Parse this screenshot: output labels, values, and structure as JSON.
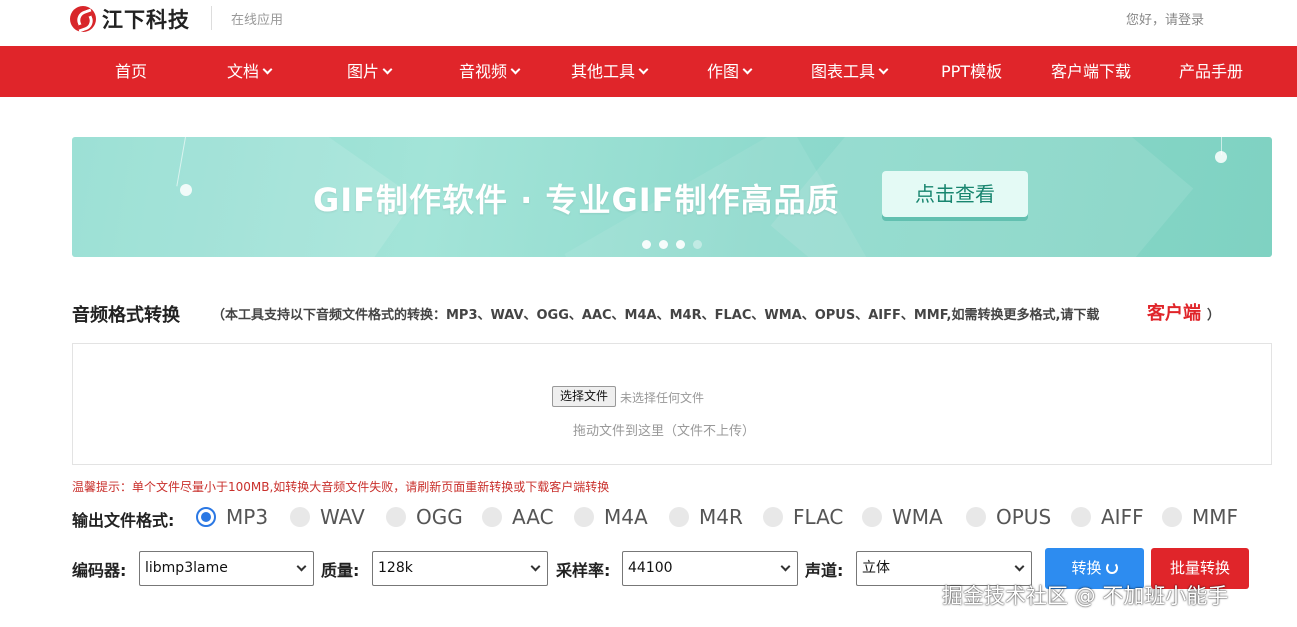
{
  "header": {
    "brand": "江下科技",
    "subtitle": "在线应用",
    "login": "您好，请登录"
  },
  "nav": {
    "items": [
      {
        "label": "首页",
        "dropdown": false
      },
      {
        "label": "文档",
        "dropdown": true
      },
      {
        "label": "图片",
        "dropdown": true
      },
      {
        "label": "音视频",
        "dropdown": true
      },
      {
        "label": "其他工具",
        "dropdown": true
      },
      {
        "label": "作图",
        "dropdown": true
      },
      {
        "label": "图表工具",
        "dropdown": true
      },
      {
        "label": "PPT模板",
        "dropdown": false
      },
      {
        "label": "客户端下载",
        "dropdown": false
      },
      {
        "label": "产品手册",
        "dropdown": false
      }
    ]
  },
  "banner": {
    "title": "GIF制作软件 · 专业GIF制作高品质",
    "button": "点击查看",
    "active_slide": 4,
    "slide_count": 4
  },
  "section": {
    "title": "音频格式转换",
    "description": "（本工具支持以下音频文件格式的转换：MP3、WAV、OGG、AAC、M4A、M4R、FLAC、WMA、OPUS、AIFF、MMF,如需转换更多格式,请下载",
    "client_link": "客户端",
    "close_paren": "）"
  },
  "upload": {
    "choose_button": "选择文件",
    "no_file": "未选择任何文件",
    "drop_hint": "拖动文件到这里（文件不上传）"
  },
  "tip": "温馨提示：单个文件尽量小于100MB,如转换大音频文件失败，请刷新页面重新转换或下载客户端转换",
  "formats": {
    "label": "输出文件格式:",
    "options": [
      "MP3",
      "WAV",
      "OGG",
      "AAC",
      "M4A",
      "M4R",
      "FLAC",
      "WMA",
      "OPUS",
      "AIFF",
      "MMF"
    ],
    "selected": "MP3"
  },
  "controls": {
    "encoder_label": "编码器:",
    "encoder_value": "libmp3lame",
    "quality_label": "质量:",
    "quality_value": "128k",
    "samplerate_label": "采样率:",
    "samplerate_value": "44100",
    "channel_label": "声道:",
    "channel_value": "立体",
    "convert_button": "转换",
    "batch_button": "批量转换"
  },
  "watermark": "掘金技术社区 @ 不加班小能手",
  "colors": {
    "nav_bg": "#e0252a",
    "primary_blue": "#2d8cf0",
    "banner_teal": "#8fdcd0"
  }
}
